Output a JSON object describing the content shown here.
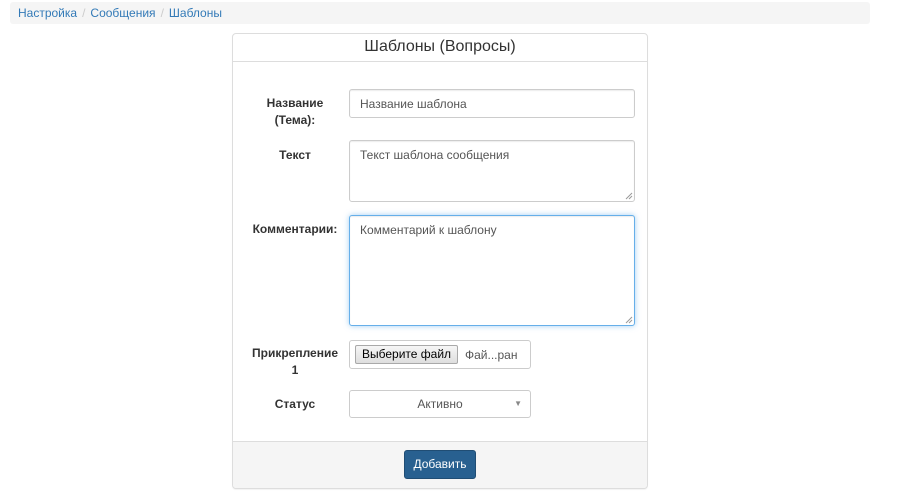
{
  "breadcrumb": {
    "items": [
      "Настройка",
      "Сообщения"
    ],
    "active": "Шаблоны",
    "separator": "/"
  },
  "panel": {
    "title": "Шаблоны (Вопросы)"
  },
  "form": {
    "name": {
      "label_line1": "Название",
      "label_line2": "(Тема):",
      "placeholder": "Название шаблона",
      "value": ""
    },
    "text": {
      "label": "Текст",
      "placeholder": "Текст шаблона сообщения",
      "value": ""
    },
    "comment": {
      "label": "Комментарии:",
      "placeholder": "Комментарий к шаблону",
      "value": ""
    },
    "attachment": {
      "label_line1": "Прикрепление",
      "label_line2": "1",
      "button_label": "Выберите файл",
      "file_status": "Фай...ран"
    },
    "status": {
      "label": "Статус",
      "selected": "Активно"
    }
  },
  "footer": {
    "submit_label": "Добавить"
  },
  "colors": {
    "link": "#337ab7",
    "primary_button": "#286090",
    "focus_border": "#66afe9"
  }
}
